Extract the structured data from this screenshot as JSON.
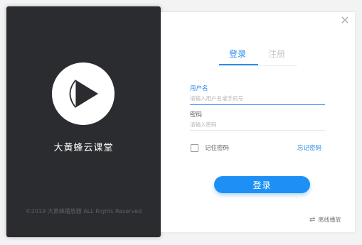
{
  "app": {
    "name": "大黄蜂云课堂",
    "copyright": "©2019 大黄蜂播放器 ALL Rights Reserved"
  },
  "tabs": {
    "login": "登录",
    "register": "注册"
  },
  "username": {
    "label": "用户名",
    "placeholder": "请输入用户名或手机号"
  },
  "password": {
    "label": "密码",
    "placeholder": "请输入密码"
  },
  "remember": {
    "label": "记住密码"
  },
  "forgot": {
    "label": "忘记密码"
  },
  "login_button": {
    "label": "登录"
  },
  "offline": {
    "label": "离线播放",
    "icon": "swap-icon"
  },
  "close": {
    "icon": "close-icon"
  },
  "colors": {
    "accent": "#2d8cf0",
    "button": "#1e90f5",
    "left_bg": "#2b2c2f"
  }
}
